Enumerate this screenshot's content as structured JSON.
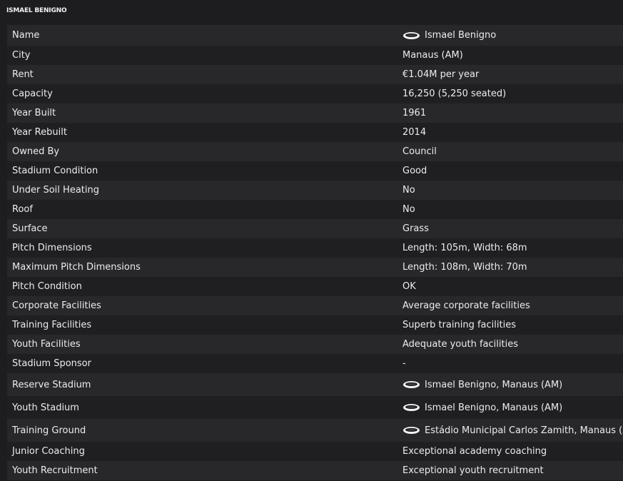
{
  "header": {
    "title": "ISMAEL BENIGNO"
  },
  "rows": [
    {
      "label": "Name",
      "value": "Ismael Benigno",
      "icon": "stadium-icon"
    },
    {
      "label": "City",
      "value": "Manaus (AM)"
    },
    {
      "label": "Rent",
      "value": "€1.04M per year"
    },
    {
      "label": "Capacity",
      "value": "16,250 (5,250 seated)"
    },
    {
      "label": "Year Built",
      "value": "1961"
    },
    {
      "label": "Year Rebuilt",
      "value": "2014"
    },
    {
      "label": "Owned By",
      "value": "Council"
    },
    {
      "label": "Stadium Condition",
      "value": "Good"
    },
    {
      "label": "Under Soil Heating",
      "value": "No"
    },
    {
      "label": "Roof",
      "value": "No"
    },
    {
      "label": "Surface",
      "value": "Grass"
    },
    {
      "label": "Pitch Dimensions",
      "value": "Length: 105m, Width: 68m"
    },
    {
      "label": "Maximum Pitch Dimensions",
      "value": "Length: 108m, Width: 70m"
    },
    {
      "label": "Pitch Condition",
      "value": "OK"
    },
    {
      "label": "Corporate Facilities",
      "value": "Average corporate facilities"
    },
    {
      "label": "Training Facilities",
      "value": "Superb training facilities"
    },
    {
      "label": "Youth Facilities",
      "value": "Adequate youth facilities"
    },
    {
      "label": "Stadium Sponsor",
      "value": "-"
    },
    {
      "label": "Reserve Stadium",
      "value": "Ismael Benigno, Manaus (AM)",
      "icon": "stadium-icon"
    },
    {
      "label": "Youth Stadium",
      "value": "Ismael Benigno, Manaus (AM)",
      "icon": "stadium-icon"
    },
    {
      "label": "Training Ground",
      "value": "Estádio Municipal Carlos Zamith, Manaus (AM)",
      "icon": "stadium-icon"
    },
    {
      "label": "Junior Coaching",
      "value": "Exceptional academy coaching"
    },
    {
      "label": "Youth Recruitment",
      "value": "Exceptional youth recruitment"
    }
  ]
}
